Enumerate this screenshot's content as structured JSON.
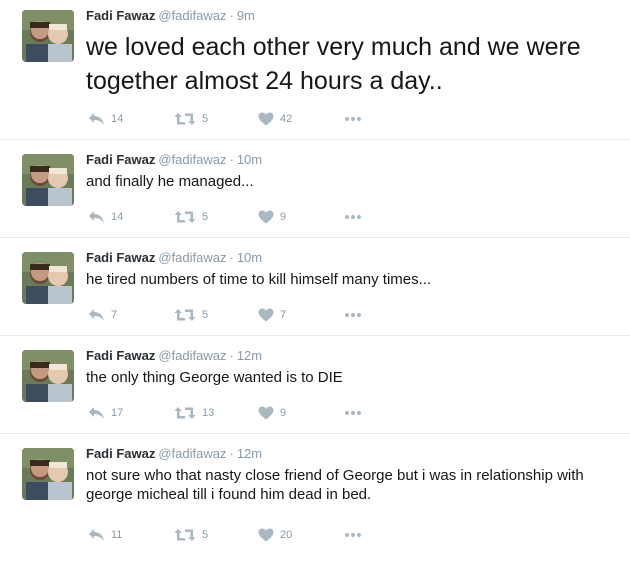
{
  "tweets": [
    {
      "name": "Fadi Fawaz",
      "handle": "@fadifawaz",
      "separator": "·",
      "time": "9m",
      "text": "we loved each other very much and we were together almost 24 hours a day..",
      "replies": "14",
      "retweets": "5",
      "likes": "42"
    },
    {
      "name": "Fadi Fawaz",
      "handle": "@fadifawaz",
      "separator": "·",
      "time": "10m",
      "text": "and finally he managed...",
      "replies": "14",
      "retweets": "5",
      "likes": "9"
    },
    {
      "name": "Fadi Fawaz",
      "handle": "@fadifawaz",
      "separator": "·",
      "time": "10m",
      "text": "he tired numbers of time to kill himself many times...",
      "replies": "7",
      "retweets": "5",
      "likes": "7"
    },
    {
      "name": "Fadi Fawaz",
      "handle": "@fadifawaz",
      "separator": "·",
      "time": "12m",
      "text": "the only thing George wanted is to DIE",
      "replies": "17",
      "retweets": "13",
      "likes": "9"
    },
    {
      "name": "Fadi Fawaz",
      "handle": "@fadifawaz",
      "separator": "·",
      "time": "12m",
      "text": "not sure who that nasty close friend of George but i was in relationship with george micheal till i found him dead in bed.",
      "replies": "11",
      "retweets": "5",
      "likes": "20"
    }
  ],
  "icons": {
    "reply": "reply-icon",
    "retweet": "retweet-icon",
    "like": "heart-icon",
    "more": "more-icon"
  },
  "colors": {
    "icon": "#aab8c2",
    "meta": "#8899a6",
    "text": "#14171a",
    "divider": "#e6ecf0"
  }
}
